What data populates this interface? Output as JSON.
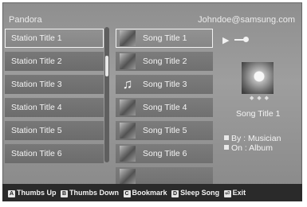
{
  "header": {
    "app_title": "Pandora",
    "account": "Johndoe@samsung.com"
  },
  "stations": [
    {
      "label": "Station Title 1",
      "selected": true
    },
    {
      "label": "Station Title 2"
    },
    {
      "label": "Station Title 3"
    },
    {
      "label": "Station Title 4"
    },
    {
      "label": "Station Title 5"
    },
    {
      "label": "Station Title 6"
    }
  ],
  "songs": [
    {
      "label": "Song Title 1",
      "thumb": "photo",
      "selected": true
    },
    {
      "label": "Song Title 2",
      "thumb": "photo"
    },
    {
      "label": "Song Title 3",
      "thumb": "note-icon"
    },
    {
      "label": "Song Title 4",
      "thumb": "photo"
    },
    {
      "label": "Song Title 5",
      "thumb": "photo"
    },
    {
      "label": "Song Title 6",
      "thumb": "photo"
    },
    {
      "label": "",
      "thumb": "photo"
    }
  ],
  "now_playing": {
    "play_icon": "▶",
    "title": "Song Title 1",
    "by": "By : Musician",
    "on": "On : Album"
  },
  "footer": {
    "items": [
      {
        "key": "A",
        "label": "Thumbs Up"
      },
      {
        "key": "B",
        "label": "Thumbs Down"
      },
      {
        "key": "C",
        "label": "Bookmark"
      },
      {
        "key": "D",
        "label": "Sleep Song"
      },
      {
        "key": "⏎",
        "label": "Exit"
      }
    ]
  }
}
